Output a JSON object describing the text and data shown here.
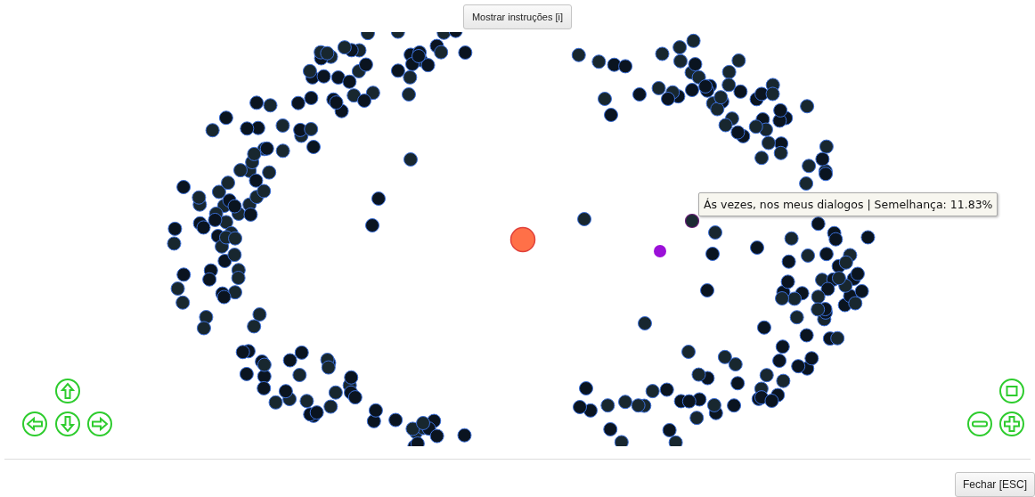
{
  "toolbar": {
    "instructions_button": "Mostrar instruções [i]"
  },
  "tooltip": {
    "text": "Ás vezes, nos meus dialogos | Semelhança: 11.83%"
  },
  "footer": {
    "close_button": "Fechar [ESC]"
  }
}
